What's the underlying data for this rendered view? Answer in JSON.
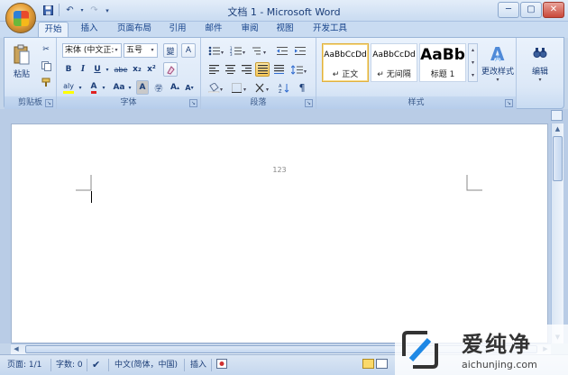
{
  "window": {
    "title": "文档 1 - Microsoft Word"
  },
  "qat": {
    "save_icon": "save-icon",
    "undo_icon": "undo-icon",
    "redo_icon": "redo-icon",
    "customize_icon": "dropdown-icon"
  },
  "window_controls": {
    "minimize": "─",
    "restore": "▢",
    "close": "✕"
  },
  "tabs": [
    "开始",
    "插入",
    "页面布局",
    "引用",
    "邮件",
    "审阅",
    "视图",
    "开发工具"
  ],
  "ribbon": {
    "clipboard": {
      "paste_label": "粘贴",
      "group_label": "剪贴板"
    },
    "font": {
      "font_name": "宋体 (中文正:",
      "font_size": "五号",
      "bold": "B",
      "italic": "I",
      "underline": "U",
      "strike": "abe",
      "subscript": "x₂",
      "superscript": "x²",
      "font_color": "A",
      "change_case": "Aa",
      "char_shading": "A",
      "enclose": "字",
      "grow": "A",
      "shrink": "A",
      "phonetic": "變",
      "clear": "A",
      "highlight": "aly",
      "group_label": "字体"
    },
    "paragraph": {
      "group_label": "段落"
    },
    "styles": {
      "items": [
        {
          "sample": "AaBbCcDd",
          "name": "↵ 正文"
        },
        {
          "sample": "AaBbCcDd",
          "name": "↵ 无间隔"
        },
        {
          "sample": "AaBb",
          "name": "标题 1"
        }
      ],
      "change_styles_label": "更改样式",
      "group_label": "样式"
    },
    "editing": {
      "label": "编辑"
    }
  },
  "document": {
    "header_text": "123"
  },
  "statusbar": {
    "page": "页面: 1/1",
    "words": "字数: 0",
    "language": "中文(简体，中国)",
    "mode": "插入"
  },
  "watermark": {
    "title": "爱纯净",
    "url": "aichunjing.com"
  }
}
